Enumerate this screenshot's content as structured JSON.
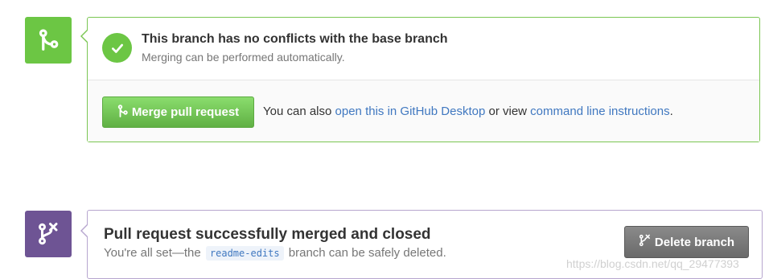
{
  "merge_check": {
    "title": "This branch has no conflicts with the base branch",
    "subtitle": "Merging can be performed automatically.",
    "icon": "git-merge-icon",
    "status_icon": "check-icon",
    "accent_color": "#6cc644",
    "merge_button_label": "Merge pull request",
    "help_prefix": "You can also ",
    "desktop_link": "open this in GitHub Desktop",
    "help_middle": " or view ",
    "cli_link": "command line instructions",
    "help_suffix": "."
  },
  "merged_notice": {
    "title": "Pull request successfully merged and closed",
    "subtitle_prefix": "You're all set—the",
    "branch_name": "readme-edits",
    "subtitle_suffix": "branch can be safely deleted.",
    "icon": "git-pull-request-closed-icon",
    "accent_color": "#6e5494",
    "delete_button_label": "Delete branch",
    "delete_button_icon": "branch-delete-icon"
  },
  "watermark": "https://blog.csdn.net/qq_29477393"
}
